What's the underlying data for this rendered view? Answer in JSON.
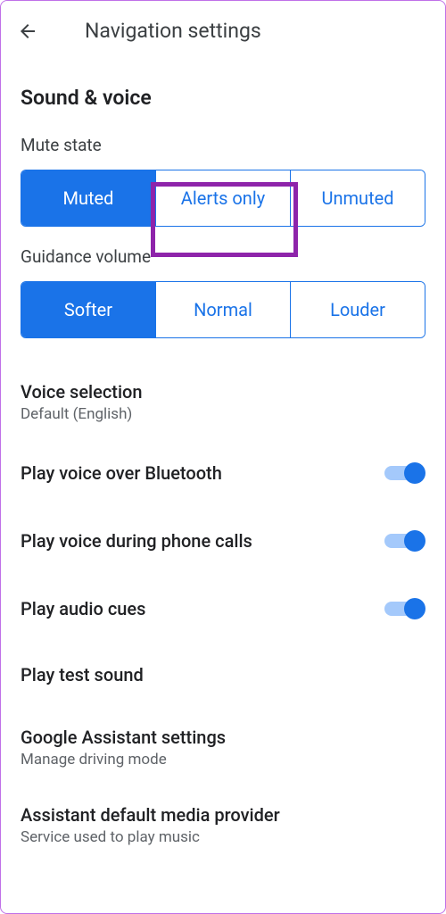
{
  "header": {
    "title": "Navigation settings"
  },
  "section": {
    "title": "Sound & voice"
  },
  "mute_state": {
    "label": "Mute state",
    "options": [
      "Muted",
      "Alerts only",
      "Unmuted"
    ],
    "selected": 0,
    "highlighted": 1
  },
  "guidance_volume": {
    "label": "Guidance volume",
    "options": [
      "Softer",
      "Normal",
      "Louder"
    ],
    "selected": 0
  },
  "voice_selection": {
    "title": "Voice selection",
    "subtitle": "Default (English)"
  },
  "toggles": {
    "bluetooth": {
      "label": "Play voice over Bluetooth",
      "on": true
    },
    "phone_calls": {
      "label": "Play voice during phone calls",
      "on": true
    },
    "audio_cues": {
      "label": "Play audio cues",
      "on": true
    }
  },
  "test_sound": {
    "label": "Play test sound"
  },
  "assistant_settings": {
    "title": "Google Assistant settings",
    "subtitle": "Manage driving mode"
  },
  "media_provider": {
    "title": "Assistant default media provider",
    "subtitle": "Service used to play music"
  }
}
